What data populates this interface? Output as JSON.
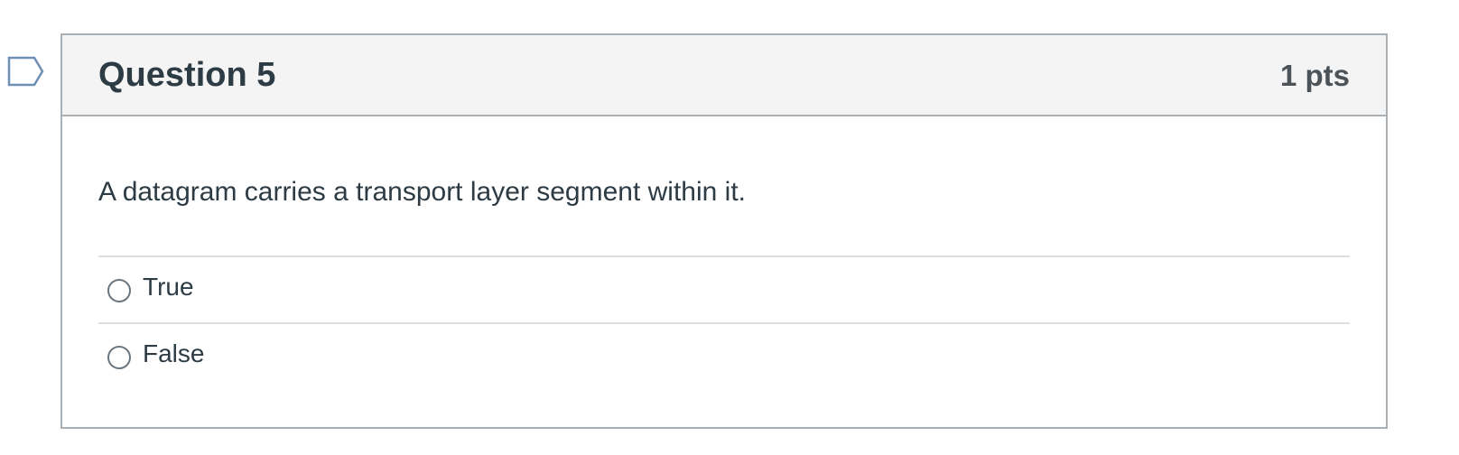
{
  "question": {
    "title": "Question 5",
    "points": "1 pts",
    "text": "A datagram carries a transport layer segment within it.",
    "flag_icon": "bookmark-flag-icon",
    "answers": [
      {
        "label": "True",
        "selected": false
      },
      {
        "label": "False",
        "selected": false
      }
    ]
  },
  "colors": {
    "border": "#a8b0b6",
    "header_bg": "#f4f4f4",
    "text": "#2d3b45",
    "divider": "#dcdfe1",
    "flag": "#6f8fb5"
  }
}
